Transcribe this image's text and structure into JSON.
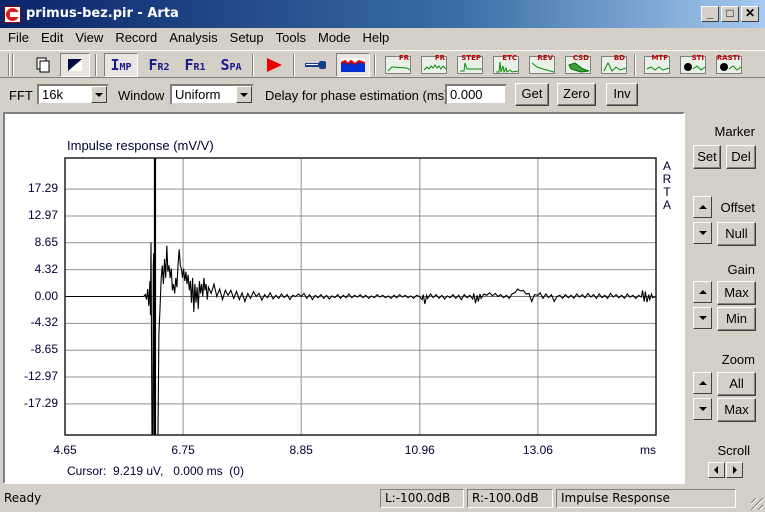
{
  "window": {
    "title": "primus-bez.pir - Arta",
    "buttons": {
      "minimize": "_",
      "maximize": "□",
      "close": "✕"
    }
  },
  "menu": [
    "File",
    "Edit",
    "View",
    "Record",
    "Analysis",
    "Setup",
    "Tools",
    "Mode",
    "Help"
  ],
  "toolbar": {
    "mode_buttons": [
      {
        "big": "I",
        "small": "MP",
        "name": "impulse"
      },
      {
        "big": "F",
        "small": "R2",
        "name": "fr2"
      },
      {
        "big": "F",
        "small": "R1",
        "name": "fr1"
      },
      {
        "big": "S",
        "small": "PA",
        "name": "spa"
      }
    ],
    "analysis_buttons": [
      "FR",
      "FR",
      "STEP",
      "ETC",
      "REV",
      "CSD",
      "BD",
      "MTF",
      "STI",
      "RASTI"
    ]
  },
  "options": {
    "fft_label": "FFT",
    "fft_value": "16k",
    "window_label": "Window",
    "window_value": "Uniform",
    "delay_label": "Delay for phase estimation (ms)",
    "delay_value": "0.000",
    "get_label": "Get",
    "zero_label": "Zero",
    "inv_label": "Inv"
  },
  "side_panel": {
    "marker_label": "Marker",
    "set_label": "Set",
    "del_label": "Del",
    "offset_label": "Offset",
    "null_label": "Null",
    "gain_label": "Gain",
    "gain_max_label": "Max",
    "gain_min_label": "Min",
    "zoom_label": "Zoom",
    "zoom_all_label": "All",
    "zoom_max_label": "Max",
    "scroll_label": "Scroll"
  },
  "plot": {
    "brand": "ARTA",
    "cursor_text": "Cursor:  9.219 uV,   0.000 ms  (0)"
  },
  "chart_data": {
    "type": "line",
    "title": "Impulse response (mV/V)",
    "xlabel": "ms",
    "ylabel": "",
    "x_ticks": [
      "4.65",
      "6.75",
      "8.85",
      "10.96",
      "13.06"
    ],
    "x_tick_values": [
      4.65,
      6.75,
      8.85,
      10.96,
      13.06
    ],
    "y_ticks": [
      "17.29",
      "12.97",
      "8.65",
      "4.32",
      "0.00",
      "-4.32",
      "-8.65",
      "-12.97",
      "-17.29"
    ],
    "y_tick_values": [
      17.29,
      12.97,
      8.65,
      4.32,
      0.0,
      -4.32,
      -8.65,
      -12.97,
      -17.29
    ],
    "xlim": [
      4.65,
      15.16
    ],
    "ylim": [
      -22.3,
      22.3
    ],
    "grid": true,
    "cursor_x": 6.25,
    "series": [
      {
        "name": "impulse",
        "points": [
          [
            4.65,
            0
          ],
          [
            6.05,
            0
          ],
          [
            6.08,
            0.3
          ],
          [
            6.1,
            -0.5
          ],
          [
            6.12,
            1.2
          ],
          [
            6.14,
            -1.5
          ],
          [
            6.16,
            2.5
          ],
          [
            6.17,
            -3
          ],
          [
            6.18,
            8.7
          ],
          [
            6.19,
            -10
          ],
          [
            6.2,
            -30
          ],
          [
            6.21,
            -30
          ],
          [
            6.22,
            5
          ],
          [
            6.23,
            7
          ],
          [
            6.24,
            -30
          ],
          [
            6.25,
            -30
          ],
          [
            6.28,
            -30
          ],
          [
            6.3,
            -25
          ],
          [
            6.32,
            -6
          ],
          [
            6.34,
            -2
          ],
          [
            6.36,
            3
          ],
          [
            6.38,
            5
          ],
          [
            6.4,
            2
          ],
          [
            6.42,
            6
          ],
          [
            6.44,
            3
          ],
          [
            6.46,
            8.2
          ],
          [
            6.48,
            4
          ],
          [
            6.5,
            5
          ],
          [
            6.52,
            3
          ],
          [
            6.54,
            4.5
          ],
          [
            6.56,
            1
          ],
          [
            6.58,
            2
          ],
          [
            6.6,
            0.5
          ],
          [
            6.62,
            3
          ],
          [
            6.64,
            1.5
          ],
          [
            6.66,
            5
          ],
          [
            6.68,
            7.6
          ],
          [
            6.7,
            5
          ],
          [
            6.72,
            4.5
          ],
          [
            6.74,
            3
          ],
          [
            6.76,
            4.5
          ],
          [
            6.78,
            2.5
          ],
          [
            6.8,
            4
          ],
          [
            6.82,
            2
          ],
          [
            6.84,
            3.5
          ],
          [
            6.86,
            1
          ],
          [
            6.88,
            2.5
          ],
          [
            6.9,
            -1
          ],
          [
            6.92,
            3
          ],
          [
            6.94,
            -2.5
          ],
          [
            6.96,
            2
          ],
          [
            6.98,
            -1
          ],
          [
            7.0,
            1.5
          ],
          [
            7.02,
            -2
          ],
          [
            7.04,
            2.5
          ],
          [
            7.06,
            0.5
          ],
          [
            7.08,
            2
          ],
          [
            7.1,
            0
          ],
          [
            7.12,
            3
          ],
          [
            7.14,
            1
          ],
          [
            7.16,
            2
          ],
          [
            7.18,
            -0.5
          ],
          [
            7.2,
            1.5
          ],
          [
            7.25,
            0.5
          ],
          [
            7.3,
            2
          ],
          [
            7.35,
            0
          ],
          [
            7.4,
            1.2
          ],
          [
            7.45,
            -0.5
          ],
          [
            7.5,
            1
          ],
          [
            7.55,
            0.2
          ],
          [
            7.6,
            1
          ],
          [
            7.65,
            -0.3
          ],
          [
            7.7,
            0.8
          ],
          [
            7.75,
            -0.5
          ],
          [
            7.8,
            0.6
          ],
          [
            7.85,
            -0.8
          ],
          [
            7.9,
            0.5
          ],
          [
            7.95,
            -0.3
          ],
          [
            8.0,
            0.8
          ],
          [
            8.05,
            0
          ],
          [
            8.1,
            0.5
          ],
          [
            8.15,
            -0.6
          ],
          [
            8.2,
            0.3
          ],
          [
            8.25,
            -0.2
          ],
          [
            8.3,
            0.6
          ],
          [
            8.35,
            -0.4
          ],
          [
            8.4,
            0.2
          ],
          [
            8.45,
            -0.3
          ],
          [
            8.5,
            0.4
          ],
          [
            8.55,
            -0.2
          ],
          [
            8.6,
            0.3
          ],
          [
            8.65,
            -0.5
          ],
          [
            8.7,
            0.2
          ],
          [
            8.75,
            0
          ],
          [
            8.8,
            0.4
          ],
          [
            8.85,
            0
          ],
          [
            8.9,
            0.5
          ],
          [
            8.95,
            -0.3
          ],
          [
            9.0,
            0.3
          ],
          [
            9.05,
            -0.5
          ],
          [
            9.1,
            0.2
          ],
          [
            9.15,
            -0.2
          ],
          [
            9.2,
            0.3
          ],
          [
            9.25,
            -0.3
          ],
          [
            9.3,
            0.2
          ],
          [
            9.35,
            -0.4
          ],
          [
            9.4,
            0.1
          ],
          [
            9.45,
            -0.2
          ],
          [
            9.5,
            0.3
          ],
          [
            9.55,
            -0.3
          ],
          [
            9.6,
            0.2
          ],
          [
            9.65,
            -0.2
          ],
          [
            9.7,
            0.4
          ],
          [
            9.75,
            -0.2
          ],
          [
            9.8,
            0.2
          ],
          [
            9.85,
            -0.1
          ],
          [
            9.9,
            0.3
          ],
          [
            9.95,
            -0.2
          ],
          [
            10.0,
            0.2
          ],
          [
            10.05,
            -0.3
          ],
          [
            10.1,
            0.1
          ],
          [
            10.15,
            -0.2
          ],
          [
            10.2,
            0.3
          ],
          [
            10.25,
            -0.1
          ],
          [
            10.3,
            0.2
          ],
          [
            10.35,
            -0.2
          ],
          [
            10.4,
            0.1
          ],
          [
            10.45,
            -0.3
          ],
          [
            10.5,
            0.2
          ],
          [
            10.55,
            -0.2
          ],
          [
            10.6,
            0.3
          ],
          [
            10.65,
            -0.1
          ],
          [
            10.7,
            0.2
          ],
          [
            10.75,
            -0.2
          ],
          [
            10.8,
            0.1
          ],
          [
            10.85,
            -0.3
          ],
          [
            10.9,
            0.2
          ],
          [
            10.95,
            0
          ],
          [
            11.0,
            -0.5
          ],
          [
            11.02,
            0.3
          ],
          [
            11.05,
            -1.2
          ],
          [
            11.08,
            0.2
          ],
          [
            11.1,
            -0.3
          ],
          [
            11.15,
            0.4
          ],
          [
            11.2,
            -0.2
          ],
          [
            11.25,
            0.3
          ],
          [
            11.3,
            -0.3
          ],
          [
            11.35,
            0.2
          ],
          [
            11.4,
            -0.4
          ],
          [
            11.45,
            0.1
          ],
          [
            11.5,
            -0.2
          ],
          [
            11.55,
            0.3
          ],
          [
            11.6,
            -0.3
          ],
          [
            11.65,
            0.2
          ],
          [
            11.7,
            -0.5
          ],
          [
            11.75,
            0.3
          ],
          [
            11.8,
            -0.2
          ],
          [
            11.85,
            0.2
          ],
          [
            11.9,
            -0.4
          ],
          [
            11.92,
            0.5
          ],
          [
            11.95,
            -1.1
          ],
          [
            11.98,
            0.2
          ],
          [
            12.0,
            -0.8
          ],
          [
            12.03,
            0.4
          ],
          [
            12.05,
            -0.3
          ],
          [
            12.1,
            0.4
          ],
          [
            12.15,
            0.2
          ],
          [
            12.2,
            0.6
          ],
          [
            12.25,
            0.1
          ],
          [
            12.3,
            0.5
          ],
          [
            12.35,
            0
          ],
          [
            12.4,
            0.3
          ],
          [
            12.45,
            -0.2
          ],
          [
            12.5,
            0.2
          ],
          [
            12.55,
            -0.3
          ],
          [
            12.6,
            0.4
          ],
          [
            12.65,
            0.6
          ],
          [
            12.7,
            1.2
          ],
          [
            12.75,
            0.9
          ],
          [
            12.8,
            1
          ],
          [
            12.85,
            0.4
          ],
          [
            12.9,
            0.5
          ],
          [
            12.95,
            -0.8
          ],
          [
            13.0,
            0.3
          ],
          [
            13.06,
            0.2
          ],
          [
            13.1,
            0.6
          ],
          [
            13.15,
            -0.3
          ],
          [
            13.2,
            0.4
          ],
          [
            13.25,
            -0.2
          ],
          [
            13.3,
            0.3
          ],
          [
            13.35,
            -0.8
          ],
          [
            13.4,
            0
          ],
          [
            13.45,
            0.2
          ],
          [
            13.5,
            -0.3
          ],
          [
            13.55,
            0.3
          ],
          [
            13.6,
            -0.2
          ],
          [
            13.65,
            0.2
          ],
          [
            13.7,
            -0.3
          ],
          [
            13.75,
            0.4
          ],
          [
            13.8,
            -0.1
          ],
          [
            13.85,
            0.3
          ],
          [
            13.9,
            -0.2
          ],
          [
            13.95,
            0.5
          ],
          [
            14.0,
            -0.1
          ],
          [
            14.05,
            0.3
          ],
          [
            14.1,
            -0.3
          ],
          [
            14.15,
            0.4
          ],
          [
            14.2,
            -0.2
          ],
          [
            14.25,
            0.2
          ],
          [
            14.3,
            -0.3
          ],
          [
            14.35,
            0.5
          ],
          [
            14.4,
            -0.1
          ],
          [
            14.45,
            0.3
          ],
          [
            14.5,
            -0.2
          ],
          [
            14.55,
            0.2
          ],
          [
            14.6,
            -0.3
          ],
          [
            14.65,
            0.4
          ],
          [
            14.7,
            -0.1
          ],
          [
            14.75,
            0.2
          ],
          [
            14.8,
            -0.3
          ],
          [
            14.85,
            0.2
          ],
          [
            14.9,
            -0.1
          ],
          [
            14.92,
            1
          ],
          [
            14.95,
            -0.8
          ],
          [
            14.97,
            0.8
          ],
          [
            15.0,
            -0.9
          ],
          [
            15.03,
            0.3
          ],
          [
            15.05,
            -0.5
          ],
          [
            15.08,
            0.4
          ],
          [
            15.1,
            -0.2
          ],
          [
            15.16,
            0
          ]
        ]
      }
    ]
  },
  "status": {
    "ready": "Ready",
    "left_level": "L:-100.0dB",
    "right_level": "R:-100.0dB",
    "mode": "Impulse Response"
  }
}
